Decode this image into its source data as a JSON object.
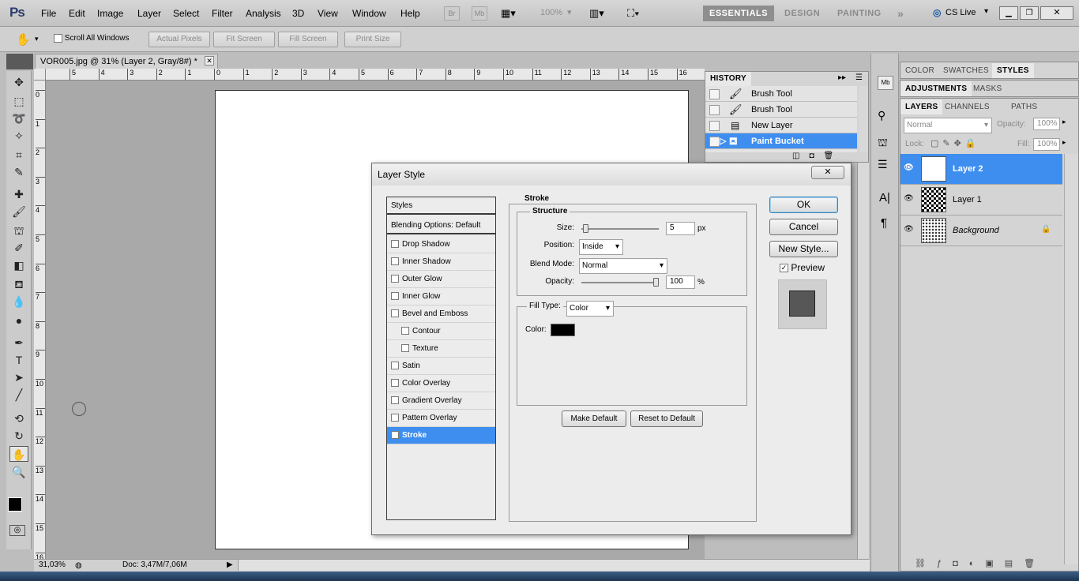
{
  "app": {
    "logo": "Ps",
    "menu": [
      "File",
      "Edit",
      "Image",
      "Layer",
      "Select",
      "Filter",
      "Analysis",
      "3D",
      "View",
      "Window",
      "Help"
    ],
    "bridge_btns": [
      "Br",
      "Mb"
    ],
    "zoom": "100%",
    "workspaces": [
      "ESSENTIALS",
      "DESIGN",
      "PAINTING"
    ],
    "workspaces_more": "»",
    "cs_live": "CS Live"
  },
  "options": {
    "scroll_all": "Scroll All Windows",
    "buttons": [
      "Actual Pixels",
      "Fit Screen",
      "Fill Screen",
      "Print Size"
    ]
  },
  "document": {
    "tab_title": "VOR005.jpg @ 31% (Layer 2, Gray/8#) *",
    "ruler_h": [
      "5",
      "4",
      "3",
      "2",
      "1",
      "0",
      "1",
      "2",
      "3",
      "4",
      "5",
      "6",
      "7",
      "8",
      "9",
      "10",
      "11",
      "12",
      "13",
      "14",
      "15",
      "16"
    ],
    "ruler_v": [
      "0",
      "1",
      "2",
      "3",
      "4",
      "5",
      "6",
      "7",
      "8",
      "9",
      "10",
      "11",
      "12",
      "13",
      "14",
      "15",
      "16"
    ],
    "zoom_pct": "31,03%",
    "doc_size": "Doc: 3,47M/7,06M"
  },
  "history": {
    "title": "HISTORY",
    "items": [
      {
        "label": "Brush Tool",
        "icon": "brush-icon"
      },
      {
        "label": "Brush Tool",
        "icon": "brush-icon"
      },
      {
        "label": "New Layer",
        "icon": "new-layer-icon"
      },
      {
        "label": "Paint Bucket",
        "icon": "paint-bucket-icon",
        "selected": true
      }
    ]
  },
  "panels": {
    "row1": [
      "COLOR",
      "SWATCHES",
      "STYLES"
    ],
    "row2": [
      "ADJUSTMENTS",
      "MASKS"
    ],
    "row3": [
      "LAYERS",
      "CHANNELS",
      "PATHS"
    ]
  },
  "layers": {
    "blend": "Normal",
    "opacity_label": "Opacity:",
    "opacity": "100%",
    "lock_label": "Lock:",
    "fill_label": "Fill:",
    "fill": "100%",
    "items": [
      {
        "name": "Layer 2",
        "selected": true
      },
      {
        "name": "Layer 1"
      },
      {
        "name": "Background",
        "locked": true
      }
    ]
  },
  "dialog": {
    "title": "Layer Style",
    "close": "✕",
    "styles_header": "Styles",
    "blending": "Blending Options: Default",
    "effects": [
      {
        "label": "Drop Shadow",
        "checked": false,
        "indent": false
      },
      {
        "label": "Inner Shadow",
        "checked": false,
        "indent": false
      },
      {
        "label": "Outer Glow",
        "checked": false,
        "indent": false
      },
      {
        "label": "Inner Glow",
        "checked": false,
        "indent": false
      },
      {
        "label": "Bevel and Emboss",
        "checked": false,
        "indent": false
      },
      {
        "label": "Contour",
        "checked": false,
        "indent": true
      },
      {
        "label": "Texture",
        "checked": false,
        "indent": true
      },
      {
        "label": "Satin",
        "checked": false,
        "indent": false
      },
      {
        "label": "Color Overlay",
        "checked": false,
        "indent": false
      },
      {
        "label": "Gradient Overlay",
        "checked": false,
        "indent": false
      },
      {
        "label": "Pattern Overlay",
        "checked": false,
        "indent": false
      },
      {
        "label": "Stroke",
        "checked": true,
        "indent": false,
        "selected": true
      }
    ],
    "stroke": {
      "title": "Stroke",
      "structure": "Structure",
      "size_label": "Size:",
      "size": "5",
      "size_unit": "px",
      "position_label": "Position:",
      "position": "Inside",
      "blend_label": "Blend Mode:",
      "blend": "Normal",
      "opacity_label": "Opacity:",
      "opacity": "100",
      "opacity_unit": "%",
      "fill_type_label": "Fill Type:",
      "fill_type": "Color",
      "color_label": "Color:",
      "color": "#000000",
      "size_fraction": 0.02,
      "opacity_fraction": 1.0
    },
    "make_default": "Make Default",
    "reset_default": "Reset to Default",
    "ok": "OK",
    "cancel": "Cancel",
    "new_style": "New Style...",
    "preview_label": "Preview",
    "preview_checked": true
  }
}
